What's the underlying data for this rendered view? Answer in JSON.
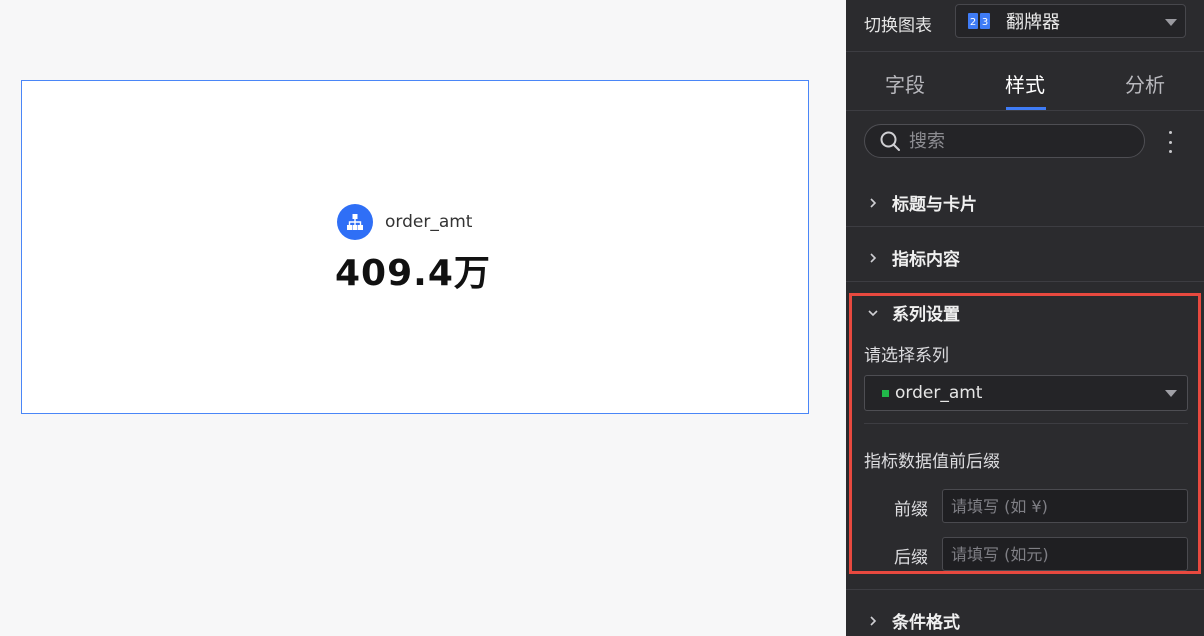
{
  "canvas": {
    "metric": {
      "name": "order_amt",
      "value": "409.4万",
      "icon": "hierarchy-icon"
    }
  },
  "panel": {
    "switch_chart_label": "切换图表",
    "chart_type": {
      "label": "翻牌器",
      "icon": "flip-counter-icon"
    },
    "tabs": [
      {
        "label": "字段",
        "active": false
      },
      {
        "label": "样式",
        "active": true
      },
      {
        "label": "分析",
        "active": false
      }
    ],
    "search": {
      "placeholder": "搜索"
    },
    "sections": {
      "title_card": "标题与卡片",
      "metric_content": "指标内容",
      "series_settings": "系列设置",
      "conditional_format": "条件格式"
    },
    "series": {
      "select_label": "请选择系列",
      "selected": "order_amt",
      "selected_color": "#21b84a",
      "affix_label": "指标数据值前后缀",
      "prefix_label": "前缀",
      "prefix_placeholder": "请填写 (如 ¥)",
      "suffix_label": "后缀",
      "suffix_placeholder": "请填写 (如元)"
    }
  },
  "colors": {
    "accent": "#3f7cf6",
    "highlight_border": "#e8493f",
    "panel_bg": "#2b2b2e"
  }
}
